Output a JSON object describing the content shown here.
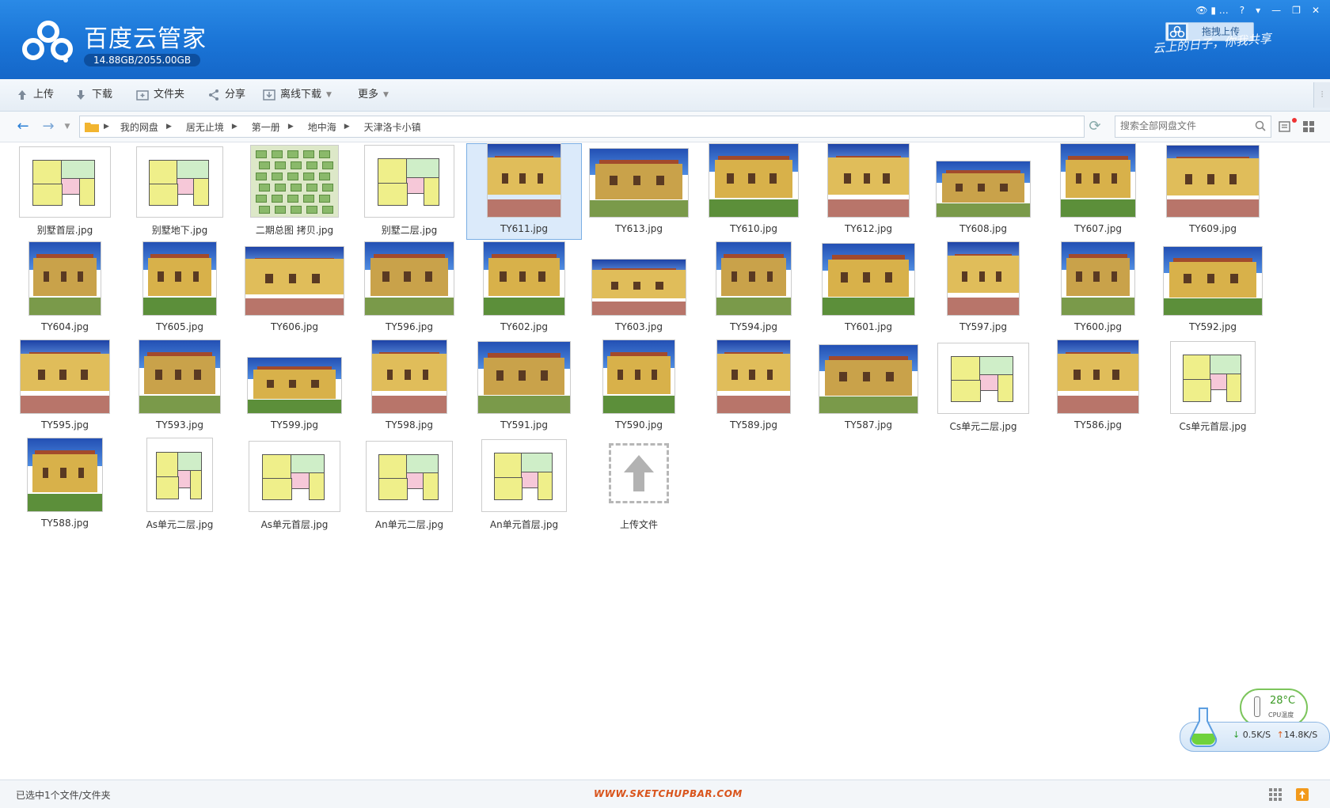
{
  "app": {
    "title": "百度云管家",
    "quota": "14.88GB/2055.00GB",
    "drag_upload_label": "拖拽上传",
    "slogan": "云上的日子，你我共享",
    "window_controls": [
      "…",
      "?",
      "▾",
      "—",
      "❐",
      "✕"
    ]
  },
  "toolbar": {
    "upload": "上传",
    "download": "下载",
    "folder": "文件夹",
    "share": "分享",
    "offline_download": "离线下载",
    "more": "更多"
  },
  "breadcrumb": [
    "我的网盘",
    "居无止境",
    "第一册",
    "地中海",
    "天津洛卡小镇"
  ],
  "search": {
    "placeholder": "搜索全部网盘文件"
  },
  "files": [
    {
      "name": "别墅首层.jpg",
      "kind": "plan"
    },
    {
      "name": "别墅地下.jpg",
      "kind": "plan"
    },
    {
      "name": "二期总图 拷贝.jpg",
      "kind": "site"
    },
    {
      "name": "别墅二层.jpg",
      "kind": "plan"
    },
    {
      "name": "TY611.jpg",
      "kind": "photo",
      "selected": true
    },
    {
      "name": "TY613.jpg",
      "kind": "photo"
    },
    {
      "name": "TY610.jpg",
      "kind": "photo"
    },
    {
      "name": "TY612.jpg",
      "kind": "photo"
    },
    {
      "name": "TY608.jpg",
      "kind": "photo"
    },
    {
      "name": "TY607.jpg",
      "kind": "photo"
    },
    {
      "name": "TY609.jpg",
      "kind": "photo"
    },
    {
      "name": "TY604.jpg",
      "kind": "photo"
    },
    {
      "name": "TY605.jpg",
      "kind": "photo"
    },
    {
      "name": "TY606.jpg",
      "kind": "photo"
    },
    {
      "name": "TY596.jpg",
      "kind": "photo"
    },
    {
      "name": "TY602.jpg",
      "kind": "photo"
    },
    {
      "name": "TY603.jpg",
      "kind": "photo"
    },
    {
      "name": "TY594.jpg",
      "kind": "photo"
    },
    {
      "name": "TY601.jpg",
      "kind": "photo"
    },
    {
      "name": "TY597.jpg",
      "kind": "photo"
    },
    {
      "name": "TY600.jpg",
      "kind": "photo"
    },
    {
      "name": "TY592.jpg",
      "kind": "photo"
    },
    {
      "name": "TY595.jpg",
      "kind": "photo"
    },
    {
      "name": "TY593.jpg",
      "kind": "photo"
    },
    {
      "name": "TY599.jpg",
      "kind": "photo"
    },
    {
      "name": "TY598.jpg",
      "kind": "photo"
    },
    {
      "name": "TY591.jpg",
      "kind": "photo"
    },
    {
      "name": "TY590.jpg",
      "kind": "photo"
    },
    {
      "name": "TY589.jpg",
      "kind": "photo"
    },
    {
      "name": "TY587.jpg",
      "kind": "photo"
    },
    {
      "name": "Cs单元二层.jpg",
      "kind": "plan"
    },
    {
      "name": "TY586.jpg",
      "kind": "photo"
    },
    {
      "name": "Cs单元首层.jpg",
      "kind": "plan"
    },
    {
      "name": "TY588.jpg",
      "kind": "photo"
    },
    {
      "name": "As单元二层.jpg",
      "kind": "plan"
    },
    {
      "name": "As单元首层.jpg",
      "kind": "plan"
    },
    {
      "name": "An单元二层.jpg",
      "kind": "plan"
    },
    {
      "name": "An单元首层.jpg",
      "kind": "plan"
    },
    {
      "name": "上传文件",
      "kind": "upload"
    }
  ],
  "monitor": {
    "temperature": "28°C",
    "temperature_caption": "CPU温度",
    "down_speed": "0.5K/S",
    "up_speed": "14.8K/S"
  },
  "status": {
    "selection": "已选中1个文件/文件夹",
    "watermark": "WWW.SKETCHUPBAR.COM"
  },
  "colors": {
    "header_blue": "#1a74d6",
    "selection_bg": "#dbeafa",
    "watermark": "#d9541c",
    "temp_green": "#3b9a24"
  }
}
